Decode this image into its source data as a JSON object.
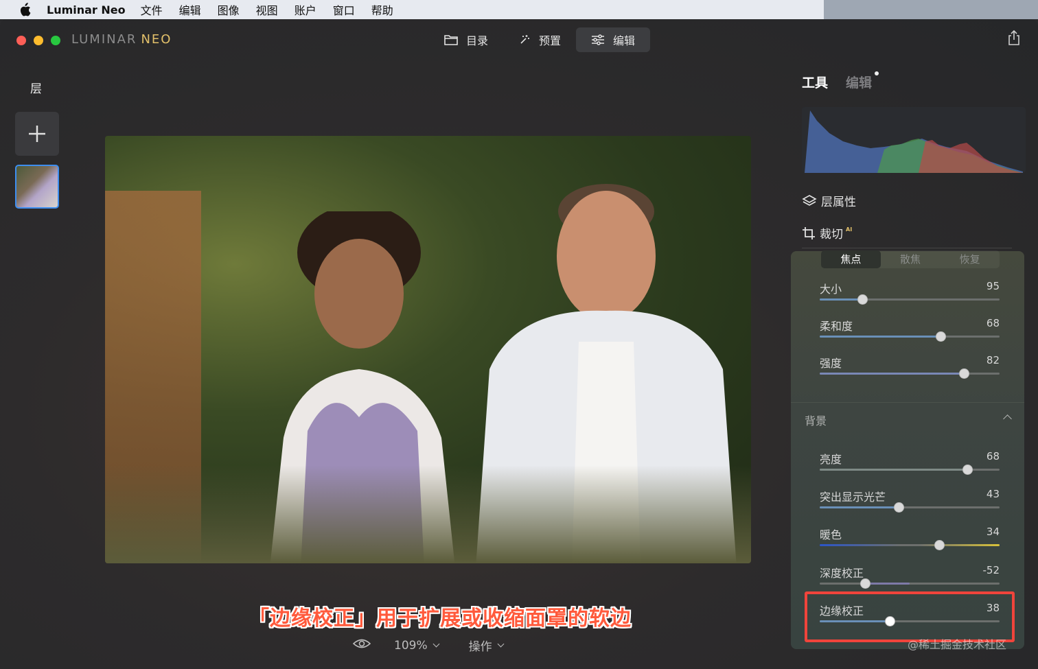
{
  "menubar": {
    "app_name": "Luminar Neo",
    "items": [
      "文件",
      "编辑",
      "图像",
      "视图",
      "账户",
      "窗口",
      "帮助"
    ]
  },
  "window": {
    "logo_main": "LUMINAR",
    "logo_neo": "NEO",
    "nav": [
      {
        "label": "目录",
        "icon": "folder-icon"
      },
      {
        "label": "预置",
        "icon": "magic-wand-icon"
      },
      {
        "label": "编辑",
        "icon": "sliders-icon",
        "active": true
      }
    ]
  },
  "layers": {
    "title": "层"
  },
  "sidebar": {
    "tab_tools": "工具",
    "tab_edit": "编辑",
    "layer_properties": "层属性",
    "crop": "裁切",
    "crop_badge": "AI",
    "segments": [
      "焦点",
      "散焦",
      "恢复"
    ],
    "active_segment": "焦点",
    "sliders_focus": [
      {
        "label": "大小",
        "value": "95",
        "fraction": 0.235
      },
      {
        "label": "柔和度",
        "value": "68",
        "fraction": 0.67
      },
      {
        "label": "强度",
        "value": "82",
        "fraction": 0.8
      }
    ],
    "background_section": "背景",
    "sliders_background": [
      {
        "label": "亮度",
        "value": "68",
        "fraction": 0.82
      },
      {
        "label": "突出显示光芒",
        "value": "43",
        "fraction": 0.44
      },
      {
        "label": "暖色",
        "value": "34",
        "fraction": 0.665
      },
      {
        "label": "深度校正",
        "value": "-52",
        "fraction": 0.25
      },
      {
        "label": "边缘校正",
        "value": "38",
        "fraction": 0.39
      }
    ]
  },
  "caption": "「边缘校正」用于扩展或收缩面罩的软边",
  "bottom": {
    "zoom": "109%",
    "ops": "操作"
  },
  "watermark": "@稀土掘金技术社区",
  "colors": {
    "accent_blue": "#3d8ef0",
    "highlight_red": "#f0443b",
    "caption_red": "#ff5a3c"
  }
}
